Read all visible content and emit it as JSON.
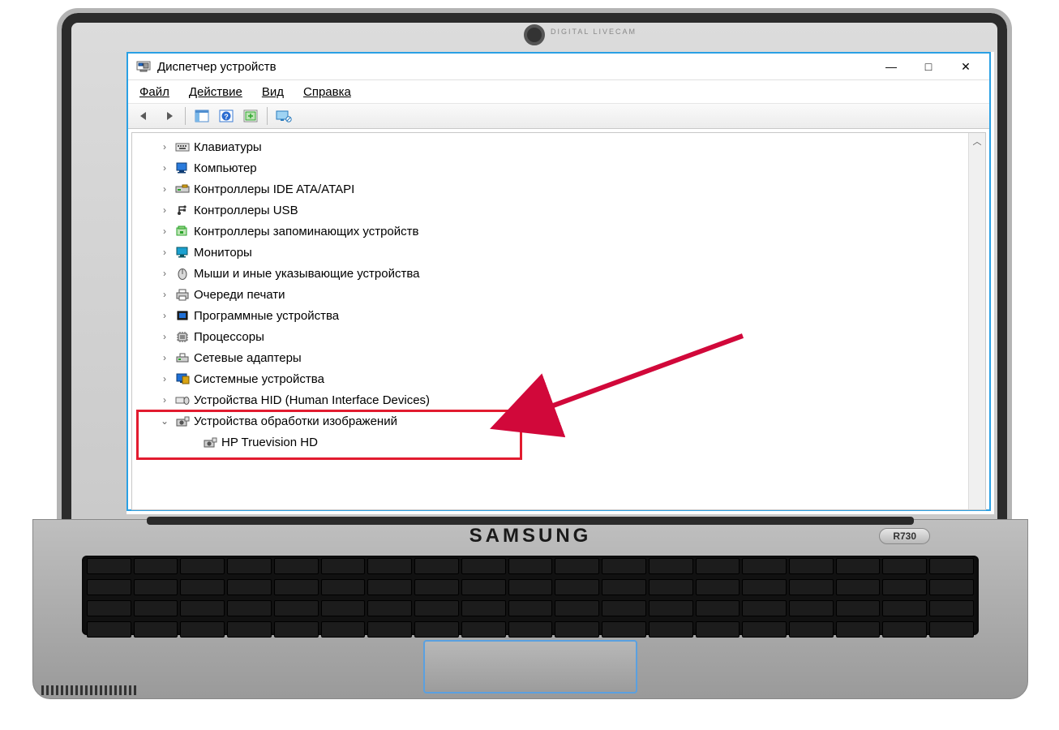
{
  "laptop": {
    "brand": "SAMSUNG",
    "model": "R730",
    "webcam_label": "DIGITAL LIVECAM"
  },
  "window": {
    "title": "Диспетчер устройств",
    "controls": {
      "minimize": "—",
      "maximize": "□",
      "close": "✕"
    },
    "menu": {
      "file": "Файл",
      "action": "Действие",
      "view": "Вид",
      "help": "Справка"
    },
    "toolbar": {
      "back": "back",
      "forward": "forward",
      "show_hidden": "show-hidden",
      "help": "help",
      "scan": "scan-hardware",
      "devices": "devices-extended"
    }
  },
  "tree": [
    {
      "icon": "keyboard",
      "label": "Клавиатуры",
      "expanded": false
    },
    {
      "icon": "computer",
      "label": "Компьютер",
      "expanded": false
    },
    {
      "icon": "ide",
      "label": "Контроллеры IDE ATA/ATAPI",
      "expanded": false
    },
    {
      "icon": "usb",
      "label": "Контроллеры USB",
      "expanded": false
    },
    {
      "icon": "storage",
      "label": "Контроллеры запоминающих устройств",
      "expanded": false
    },
    {
      "icon": "monitor",
      "label": "Мониторы",
      "expanded": false
    },
    {
      "icon": "mouse",
      "label": "Мыши и иные указывающие устройства",
      "expanded": false
    },
    {
      "icon": "printer",
      "label": "Очереди печати",
      "expanded": false
    },
    {
      "icon": "firmware",
      "label": "Программные устройства",
      "expanded": false
    },
    {
      "icon": "cpu",
      "label": "Процессоры",
      "expanded": false
    },
    {
      "icon": "network",
      "label": "Сетевые адаптеры",
      "expanded": false
    },
    {
      "icon": "system",
      "label": "Системные устройства",
      "expanded": false
    },
    {
      "icon": "hid",
      "label": "Устройства HID (Human Interface Devices)",
      "expanded": false
    },
    {
      "icon": "imaging",
      "label": "Устройства обработки изображений",
      "expanded": true,
      "children": [
        {
          "icon": "camera",
          "label": "HP Truevision HD"
        }
      ]
    }
  ],
  "highlight": {
    "category_index": 13
  },
  "annotation": {
    "arrow_color": "#d1083a"
  }
}
